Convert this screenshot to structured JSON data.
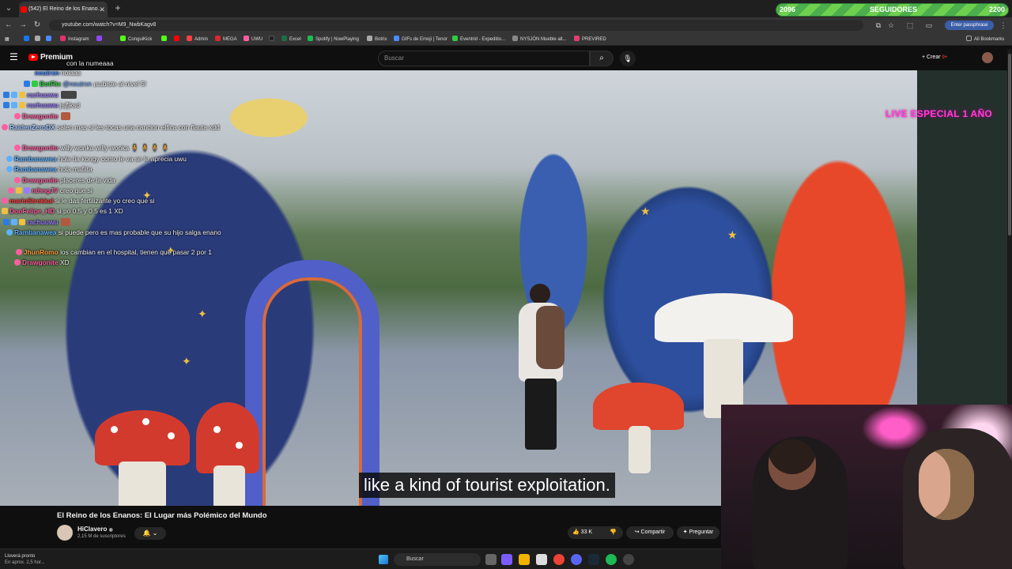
{
  "browser": {
    "tab_title": "(542) El Reino de los Enano...",
    "url": "youtube.com/watch?v=M9_NwbKagv8",
    "pass_button": "Enter passphrase",
    "bookmarks": [
      "Instagram",
      "ConguiKick",
      "Admin",
      "MEGA",
      "UWU",
      "Excel",
      "Spotify | NowPlaying",
      "Botrix",
      "GIFs de Emoji | Tenor",
      "Eventrid - Expeditio...",
      "NYSJÓN Mueble alt...",
      "PREVIRED"
    ],
    "all_bookmarks": "All Bookmarks"
  },
  "follow_goal": {
    "current": "2096",
    "label": "SEGUIDORES",
    "target": "2200",
    "fill_fraction": 0.95
  },
  "youtube": {
    "brand": "Premium",
    "search_placeholder": "Buscar",
    "create_label": "Crear",
    "notif_count": "9+"
  },
  "video": {
    "subtitle": "like a kind of tourist exploitation.",
    "title": "El Reino de los Enanos: El Lugar más Polémico del Mundo",
    "channel": "HiClavero",
    "subscribers": "2,15 M de suscriptores",
    "likes": "33 K",
    "share_label": "Compartir",
    "ask_label": "Preguntar"
  },
  "overlay": {
    "live_banner": "LIVE ESPECIAL 1 AÑO",
    "top_ghost": "con la numeaaa"
  },
  "chat": [
    {
      "name": "neutrxn",
      "color": "#4a8cff",
      "msg": "holaaa"
    },
    {
      "name": "BotRix",
      "color": "#2ecc40",
      "msg": "@neutrxn ¡subiste al nivel 5!"
    },
    {
      "name": "rachuuwu",
      "color": "#9b7bff",
      "msg": ""
    },
    {
      "name": "rachuuwu",
      "color": "#9b7bff",
      "msg": "jsjfjksd"
    },
    {
      "name": "Drawgonite",
      "color": "#ff5ea0",
      "msg": ""
    },
    {
      "name": "RaidenZeroDX",
      "color": "#a0c4ff",
      "msg": "salen mas si les tocas una cancion elfica con flauta xdd"
    },
    {
      "name": "Drawgonite",
      "color": "#ff5ea0",
      "msg": "willy wonka willy wonka"
    },
    {
      "name": "Rambanawea",
      "color": "#5fb0ff",
      "msg": "hola tia kongy como le va se le aprecia uwu"
    },
    {
      "name": "Rambanawea",
      "color": "#5fb0ff",
      "msg": "hola mafiita"
    },
    {
      "name": "Drawgonite",
      "color": "#ff5ea0",
      "msg": "placeres de la vida"
    },
    {
      "name": "nthngJV",
      "color": "#ff5ea0",
      "msg": "creo que si"
    },
    {
      "name": "marioStrekkal",
      "color": "#ff3b3b",
      "msg": "si le das fertilizante yo creo que si"
    },
    {
      "name": "DonFelipe_HD",
      "color": "#ff5ea0",
      "msg": "si po 0.5 y 0.5 es 1 XD"
    },
    {
      "name": "rachuuwu",
      "color": "#9b7bff",
      "msg": ""
    },
    {
      "name": "Rambanawea",
      "color": "#5fb0ff",
      "msg": "si puede pero es mas probable que su hijo salga enano"
    },
    {
      "name": "JhunRomo",
      "color": "#ff9a3c",
      "msg": "los cambian en el hospital, tienen que pasar 2 por 1"
    },
    {
      "name": "Drawgonite",
      "color": "#ff5ea0",
      "msg": "XD"
    }
  ],
  "taskbar": {
    "weather_title": "Lloverá pronto",
    "weather_sub": "En aprox. 2,5 hor...",
    "search": "Buscar"
  }
}
